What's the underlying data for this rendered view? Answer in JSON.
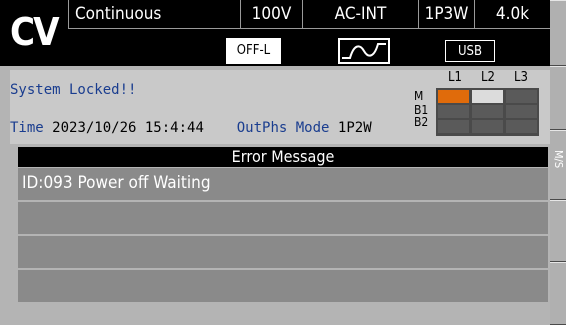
{
  "status": {
    "mode": "CV",
    "operation": "Continuous",
    "voltage_range": "100V",
    "source": "AC-INT",
    "phase_config": "1P3W",
    "frequency": "4.0k",
    "output_state": "OFF-L",
    "waveform_icon": "sine-wave-icon",
    "interface": "USB"
  },
  "info": {
    "lock_message": "System Locked!!",
    "time_label": "Time",
    "time_value": "2023/10/26 15:4:44",
    "outphs_label": "OutPhs Mode",
    "outphs_value": "1P2W"
  },
  "phase_grid": {
    "columns": [
      "L1",
      "L2",
      "L3"
    ],
    "rows": [
      "M",
      "B1",
      "B2"
    ],
    "active_color": "#e06b0b",
    "inactive_color": "#dcdcdc"
  },
  "error_panel": {
    "title": "Error Message",
    "rows": [
      "ID:093 Power off Waiting",
      "",
      "",
      ""
    ]
  },
  "side_key": {
    "label": "M/S"
  }
}
